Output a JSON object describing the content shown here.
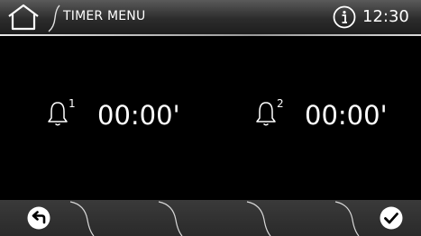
{
  "header": {
    "title": "TIMER MENU",
    "time": "12:30",
    "home_icon": "home-icon",
    "info_icon": "info-icon"
  },
  "timers": [
    {
      "number": "1",
      "value": "00:00'",
      "icon": "bell-icon"
    },
    {
      "number": "2",
      "value": "00:00'",
      "icon": "bell-icon"
    }
  ],
  "bottom_bar": {
    "back_icon": "back-arrow-icon",
    "confirm_icon": "checkmark-icon"
  },
  "colors": {
    "background": "#000000",
    "bar": "#2e2e2e",
    "text": "#ffffff"
  }
}
